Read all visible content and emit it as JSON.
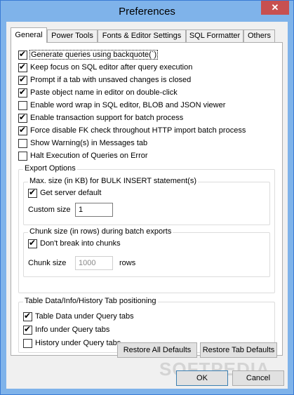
{
  "window": {
    "title": "Preferences",
    "close_glyph": "✕"
  },
  "tabs": [
    {
      "label": "General",
      "active": true
    },
    {
      "label": "Power Tools"
    },
    {
      "label": "Fonts & Editor Settings"
    },
    {
      "label": "SQL Formatter"
    },
    {
      "label": "Others"
    }
  ],
  "options": [
    {
      "label": "Generate queries using backquote(`)",
      "checked": true
    },
    {
      "label": "Keep focus on SQL editor after query execution",
      "checked": true
    },
    {
      "label": "Prompt if a tab with unsaved changes is closed",
      "checked": true
    },
    {
      "label": "Paste object name in editor on double-click",
      "checked": true
    },
    {
      "label": "Enable word wrap in SQL editor, BLOB and JSON viewer",
      "checked": false
    },
    {
      "label": "Enable transaction support for batch process",
      "checked": true
    },
    {
      "label": "Force disable FK check throughout HTTP import batch process",
      "checked": true
    },
    {
      "label": "Show Warning(s) in Messages tab",
      "checked": false
    },
    {
      "label": "Halt Execution of Queries on Error",
      "checked": false
    }
  ],
  "export": {
    "title": "Export Options",
    "bulk": {
      "title": "Max. size (in KB) for BULK INSERT statement(s)",
      "get_server_default": "Get server default",
      "custom_size_label": "Custom size",
      "custom_size_value": "1"
    },
    "chunk": {
      "title": "Chunk size (in rows) during batch exports",
      "dont_break": "Don't break into chunks",
      "chunk_size_label": "Chunk size",
      "chunk_size_value": "1000",
      "rows_label": "rows"
    }
  },
  "positioning": {
    "title": "Table Data/Info/History Tab positioning",
    "items": [
      {
        "label": "Table Data under Query tabs",
        "checked": true
      },
      {
        "label": "Info under Query tabs",
        "checked": true
      },
      {
        "label": "History under Query tabs",
        "checked": false
      }
    ]
  },
  "buttons": {
    "restore_all": "Restore All Defaults",
    "restore_tab": "Restore Tab Defaults",
    "ok": "OK",
    "cancel": "Cancel"
  },
  "watermark": "SOFTPEDIA"
}
